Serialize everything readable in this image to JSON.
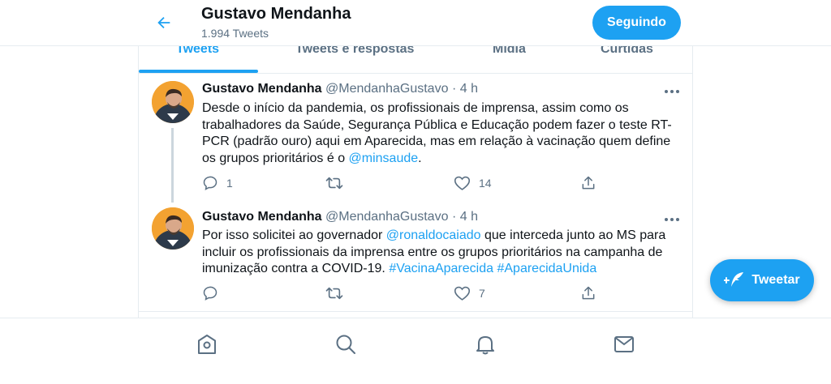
{
  "header": {
    "name": "Gustavo Mendanha",
    "tweet_count": "1.994 Tweets",
    "follow_label": "Seguindo"
  },
  "tabs": [
    {
      "label": "Tweets",
      "active": true
    },
    {
      "label": "Tweets e respostas",
      "active": false
    },
    {
      "label": "Mídia",
      "active": false
    },
    {
      "label": "Curtidas",
      "active": false
    }
  ],
  "tweets": [
    {
      "name": "Gustavo Mendanha",
      "handle": "@MendanhaGustavo",
      "dot": "·",
      "time": "4 h",
      "body_1": "Desde o início da pandemia, os profissionais de imprensa, assim como os trabalhadores da Saúde, Segurança Pública e Educação podem fazer o teste RT-PCR (padrão ouro) aqui em Aparecida, mas em relação à vacinação quem define os grupos prioritários é o ",
      "mention": "@minsaude",
      "body_2": ".",
      "replies": "1",
      "retweets": "",
      "likes": "14"
    },
    {
      "name": "Gustavo Mendanha",
      "handle": "@MendanhaGustavo",
      "dot": "·",
      "time": "4 h",
      "body_1": "Por isso solicitei ao governador ",
      "mention": "@ronaldocaiado",
      "body_2": " que interceda junto ao MS para incluir os profissionais da imprensa entre os grupos prioritários na campanha de imunização contra a COVID-19. ",
      "hashtag_1": "#VacinaAparecida",
      "space": " ",
      "hashtag_2": "#AparecidaUnida",
      "replies": "",
      "retweets": "",
      "likes": "7"
    }
  ],
  "fab": {
    "label": "Tweetar"
  },
  "icons": {
    "back": "arrow-left-icon",
    "more": "more-horizontal-icon",
    "reply": "reply-icon",
    "retweet": "retweet-icon",
    "like": "heart-icon",
    "share": "share-icon",
    "home": "home-icon",
    "search": "search-icon",
    "notifications": "bell-icon",
    "messages": "mail-icon",
    "compose": "feather-plus-icon"
  },
  "colors": {
    "accent": "#1da1f2",
    "text": "#0f1419",
    "secondary": "#5b7083",
    "border": "#e6ecf0"
  }
}
